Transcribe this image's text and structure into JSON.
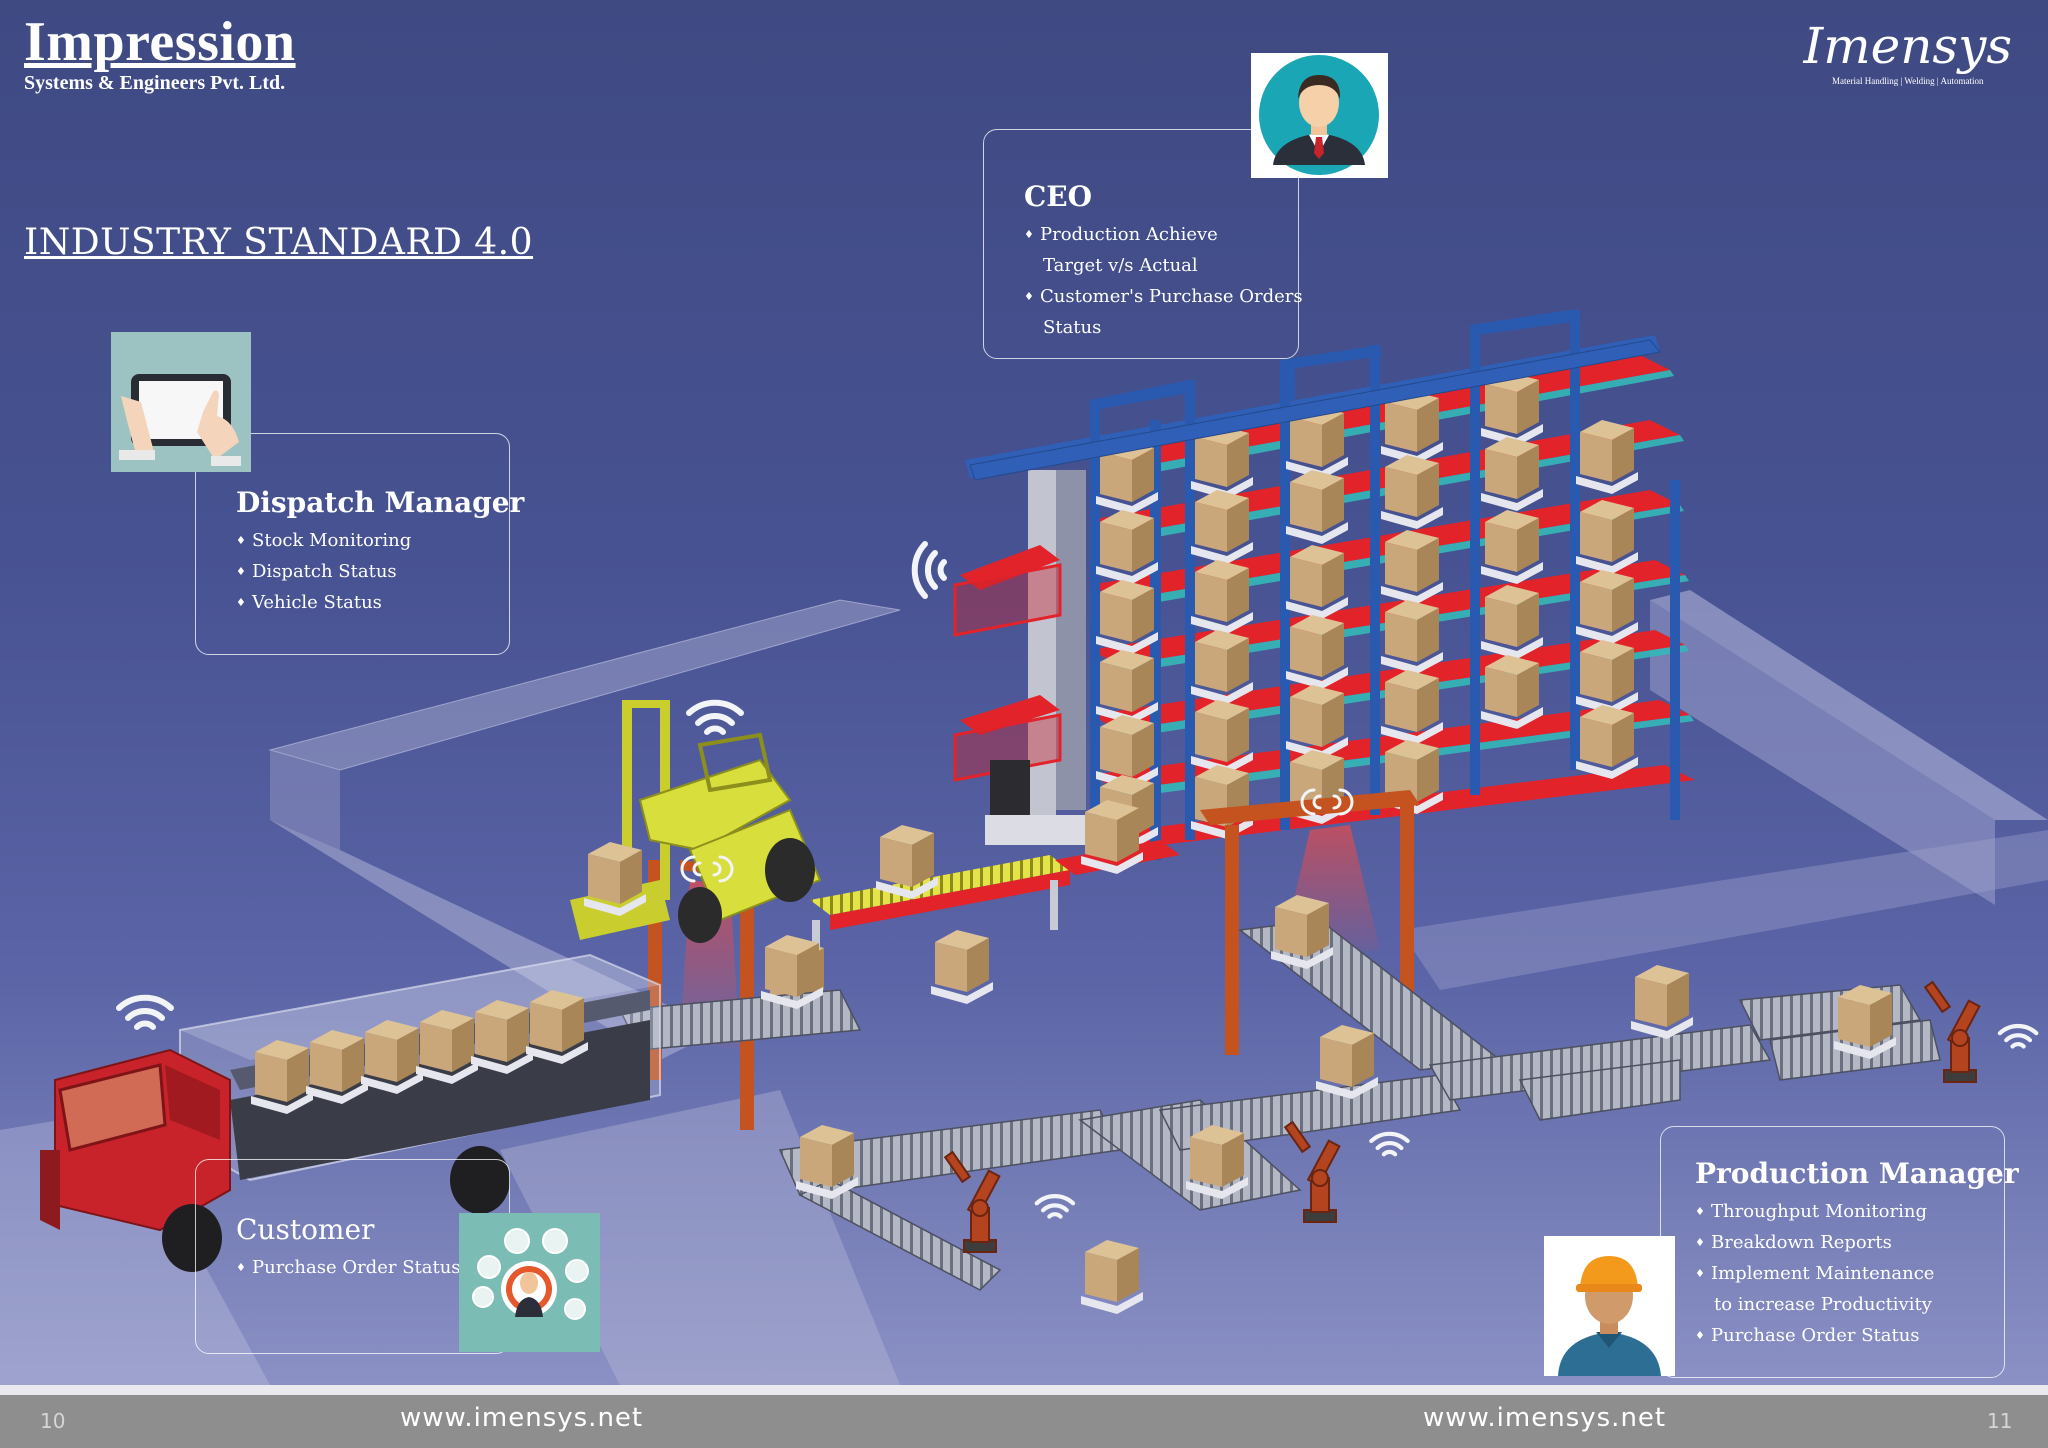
{
  "header": {
    "company": "Impression",
    "company_sub": "Systems & Engineers Pvt. Ltd.",
    "logo_word": "Imensys",
    "logo_tagline": "Material Handling | Welding | Automation"
  },
  "heading": "INDUSTRY STANDARD 4.0",
  "roles": {
    "ceo": {
      "title": "CEO",
      "items": [
        "Production Achieve",
        "Target v/s Actual",
        "Customer's Purchase Orders",
        "Status"
      ],
      "icon": "ceo-avatar-icon"
    },
    "dispatch": {
      "title": "Dispatch Manager",
      "items": [
        "Stock Monitoring",
        "Dispatch Status",
        "Vehicle Status"
      ],
      "icon": "tablet-icon"
    },
    "customer": {
      "title": "Customer",
      "items": [
        "Purchase Order Status"
      ],
      "icon": "customer-network-icon"
    },
    "production": {
      "title": "Production Manager",
      "items": [
        "Throughput Monitoring",
        "Breakdown Reports",
        "Implement Maintenance",
        "to increase Productivity",
        "Purchase Order Status"
      ],
      "icon": "worker-avatar-icon"
    }
  },
  "footer": {
    "page_left": "10",
    "page_right": "11",
    "url_left": "www.imensys.net",
    "url_right": "www.imensys.net"
  },
  "colors": {
    "background": "#475292",
    "rack_blue": "#2f5fb6",
    "shelf_red": "#e2232a",
    "box_brown": "#c9a77a",
    "forklift_yellow": "#d8de3c",
    "truck_red": "#c8232b",
    "robot_orange": "#b3441f",
    "footer_gray": "#8e8e8e"
  }
}
